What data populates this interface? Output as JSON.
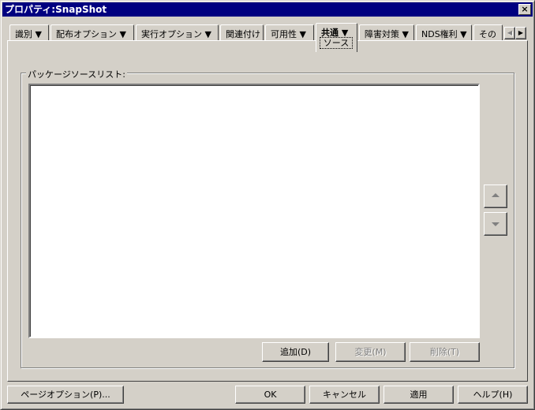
{
  "window": {
    "title": "プロパティ:SnapShot",
    "close_label": "×"
  },
  "tabs": [
    {
      "label": "識別 ▼"
    },
    {
      "label": "配布オプション ▼"
    },
    {
      "label": "実行オプション ▼"
    },
    {
      "label": "関連付け"
    },
    {
      "label": "可用性 ▼"
    },
    {
      "label": "共通 ▼",
      "subtab": "ソース",
      "active": true
    },
    {
      "label": "障害対策 ▼"
    },
    {
      "label": "NDS権利 ▼"
    },
    {
      "label": "その"
    }
  ],
  "tab_scroll": {
    "left": "◀",
    "right": "▶"
  },
  "group": {
    "label": "パッケージソースリスト:"
  },
  "list": {
    "items": []
  },
  "list_buttons": {
    "add": "追加(D)",
    "modify": "変更(M)",
    "delete": "削除(T)"
  },
  "footer": {
    "page_options": "ページオプション(P)...",
    "ok": "OK",
    "cancel": "キャンセル",
    "apply": "適用",
    "help": "ヘルプ(H)"
  }
}
